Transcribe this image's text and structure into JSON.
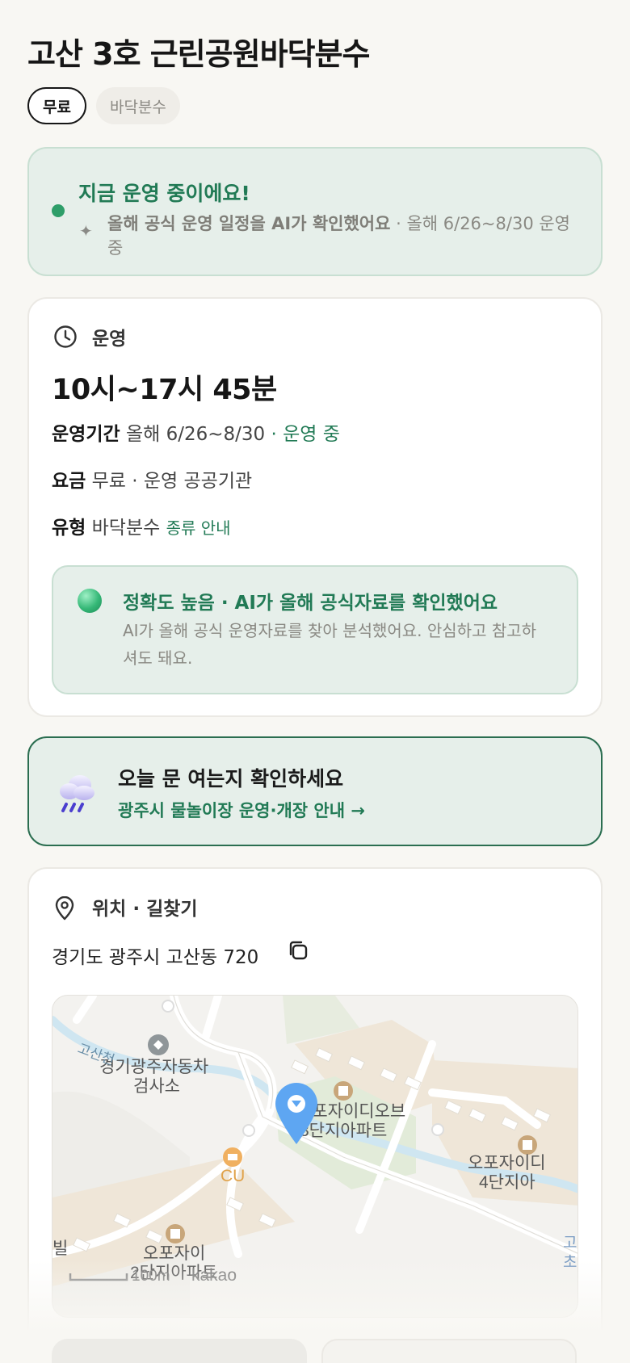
{
  "title": "고산 3호 근린공원바닥분수",
  "chips": [
    "무료",
    "바닥분수"
  ],
  "status": {
    "headline": "지금 운영 중이에요!",
    "note_bold": "올해 공식 운영 일정을 AI가 확인했어요",
    "note_rest": " · 올해 6/26~8/30 운영 중"
  },
  "ops": {
    "section": "운영",
    "hours": "10시~17시 45분",
    "period_label": "운영기간",
    "period_value": "올해 6/26~8/30",
    "period_status": "· 운영 중",
    "fee_label": "요금",
    "fee_value": "무료 · 운영 공공기관",
    "type_label": "유형",
    "type_value": "바닥분수",
    "type_link": "종류 안내",
    "accuracy": {
      "headline": "정확도 높음 · AI가 올해 공식자료를 확인했어요",
      "body": "AI가 올해 공식 운영자료를 찾아 분석했어요. 안심하고 참고하셔도 돼요."
    }
  },
  "banner": {
    "headline": "오늘 문 여는지 확인하세요",
    "link": "광주시 물놀이장 운영·개장 안내 →",
    "icon": "rain-cloud-icon"
  },
  "location": {
    "section": "위치 · 길찾기",
    "address": "경기도 광주시 고산동 720",
    "map_labels": {
      "stream": "고산천",
      "inspection": [
        "경기광주자동차",
        "검사소"
      ],
      "apt_center": [
        "오포자이디오브",
        "3단지아파트"
      ],
      "apt_right": [
        "오포자이디",
        "4단지아"
      ],
      "apt_bottom": [
        "오포자이",
        "2단지아파트"
      ],
      "store": "CU",
      "scale": "100m",
      "brand": "kakao",
      "edge_left": "빌",
      "edge_right": [
        "고",
        "초"
      ]
    }
  },
  "colors": {
    "accent": "#217a55",
    "status_bg": "#e6efea",
    "page_bg": "#f8f7f3"
  }
}
